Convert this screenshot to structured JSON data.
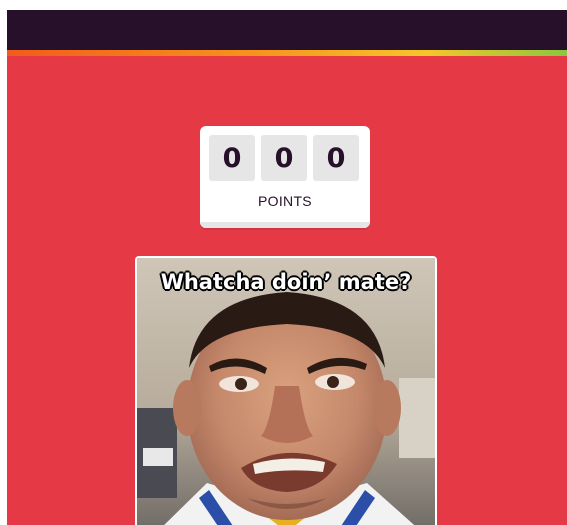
{
  "header": {
    "bar_color": "#26102a",
    "accent_colors": [
      "#f25c1b",
      "#f7941d",
      "#f5c62a",
      "#8cc63f"
    ]
  },
  "background_color": "#e63946",
  "score": {
    "digits": [
      "0",
      "0",
      "0"
    ],
    "label": "POINTS"
  },
  "meme": {
    "caption": "Whatcha doin’ mate?",
    "image_icon": "grimacing-face-photo"
  }
}
